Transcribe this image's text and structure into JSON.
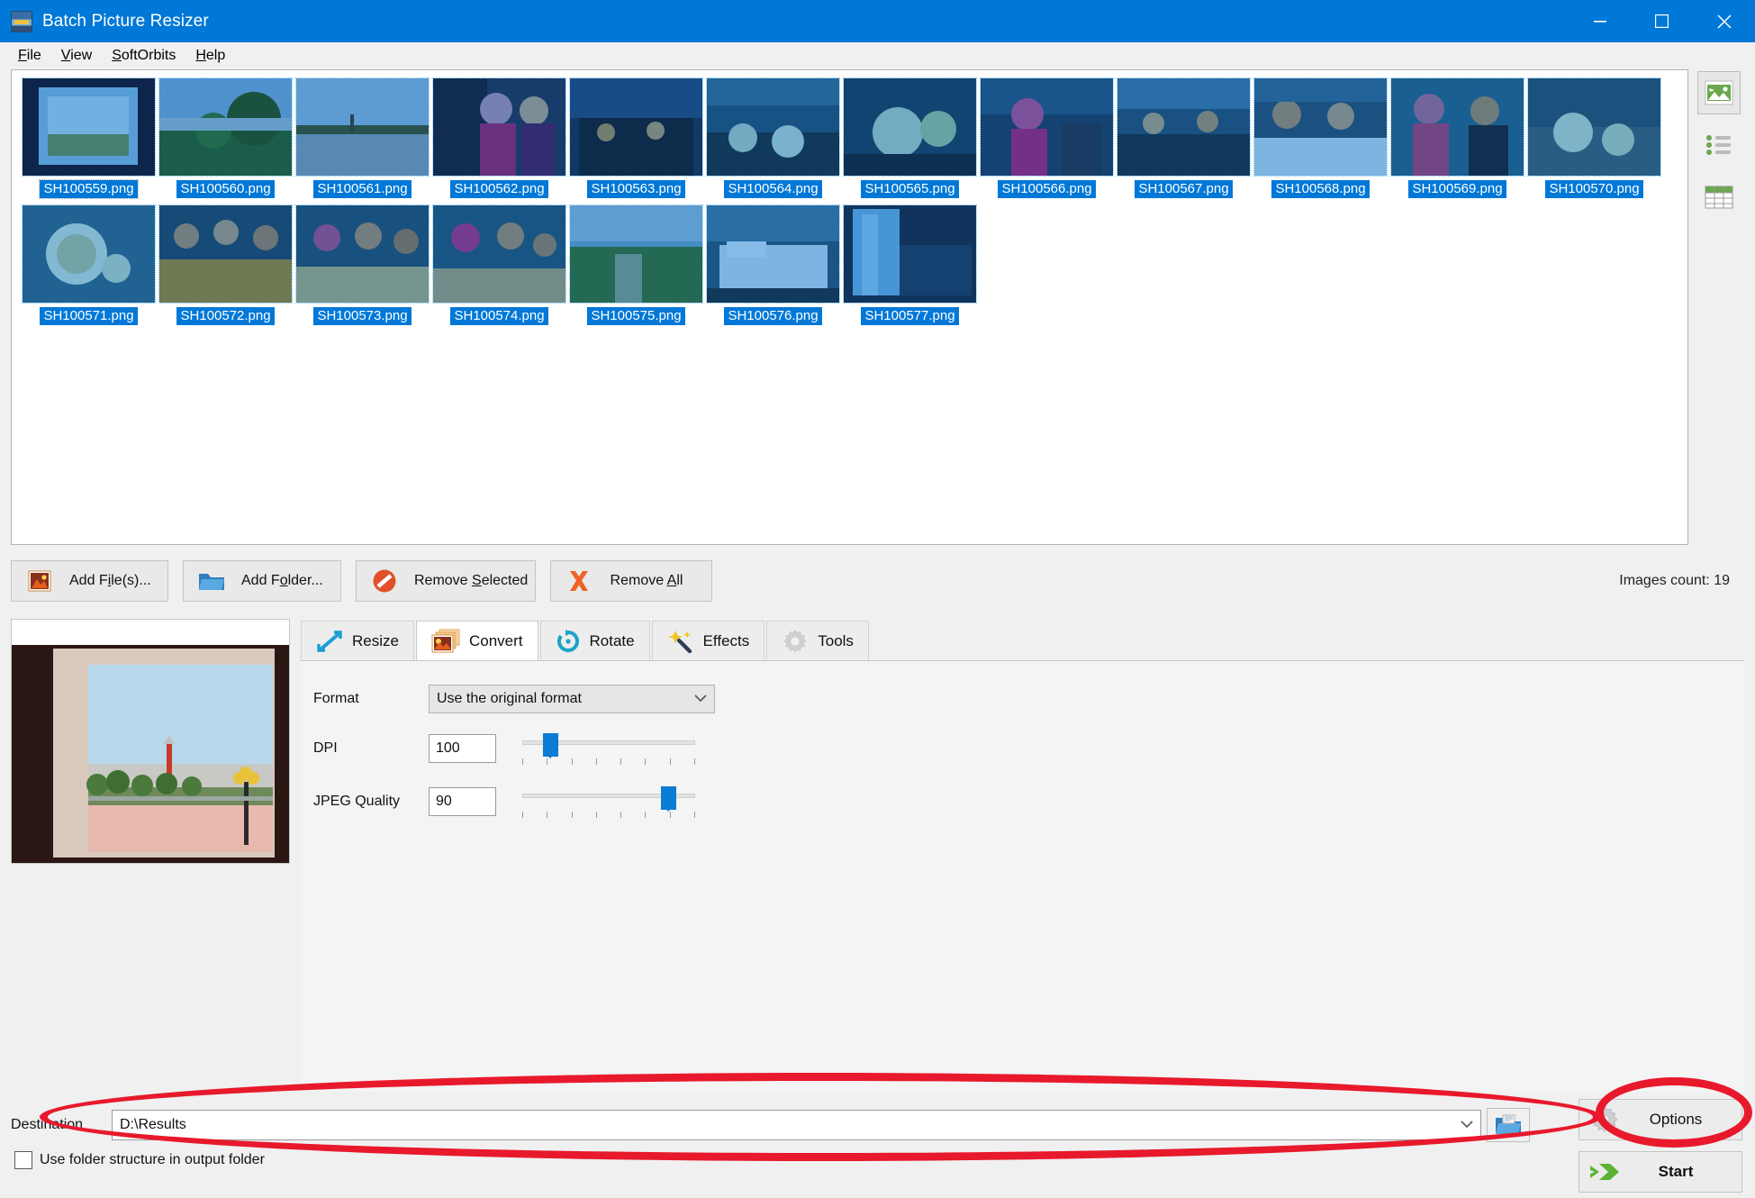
{
  "window": {
    "title": "Batch Picture Resizer",
    "icon": "app-icon",
    "minimize": "minimize-icon",
    "maximize": "maximize-icon",
    "close": "close-icon"
  },
  "menu": [
    {
      "label": "File",
      "mnemonic": "F"
    },
    {
      "label": "View",
      "mnemonic": "V"
    },
    {
      "label": "SoftOrbits",
      "mnemonic": "S"
    },
    {
      "label": "Help",
      "mnemonic": "H"
    }
  ],
  "thumbnails": [
    {
      "label": "SH100559.png",
      "scene": "window-view"
    },
    {
      "label": "SH100560.png",
      "scene": "garden"
    },
    {
      "label": "SH100561.png",
      "scene": "promenade"
    },
    {
      "label": "SH100562.png",
      "scene": "people-night"
    },
    {
      "label": "SH100563.png",
      "scene": "lobby"
    },
    {
      "label": "SH100564.png",
      "scene": "buffet"
    },
    {
      "label": "SH100565.png",
      "scene": "buffet-table"
    },
    {
      "label": "SH100566.png",
      "scene": "restaurant"
    },
    {
      "label": "SH100567.png",
      "scene": "terrace"
    },
    {
      "label": "SH100568.png",
      "scene": "table-people"
    },
    {
      "label": "SH100569.png",
      "scene": "couple-table"
    },
    {
      "label": "SH100570.png",
      "scene": "food-plate"
    },
    {
      "label": "SH100571.png",
      "scene": "food-dish"
    },
    {
      "label": "SH100572.png",
      "scene": "group-dinner"
    },
    {
      "label": "SH100573.png",
      "scene": "group-table"
    },
    {
      "label": "SH100574.png",
      "scene": "family-table"
    },
    {
      "label": "SH100575.png",
      "scene": "garden-path"
    },
    {
      "label": "SH100576.png",
      "scene": "hotel-bed"
    },
    {
      "label": "SH100577.png",
      "scene": "room-curtain"
    }
  ],
  "view_modes": [
    {
      "name": "thumbnail-view",
      "active": true
    },
    {
      "name": "list-view",
      "active": false
    },
    {
      "name": "details-view",
      "active": false
    }
  ],
  "actions": {
    "add_files": {
      "pre": "Add F",
      "mn": "i",
      "post": "le(s)..."
    },
    "add_folder": {
      "pre": "Add F",
      "mn": "o",
      "post": "lder..."
    },
    "remove_selected": {
      "pre": "Remove ",
      "mn": "S",
      "post": "elected"
    },
    "remove_all": {
      "pre": "Remove ",
      "mn": "A",
      "post": "ll"
    },
    "images_count": "Images count: 19"
  },
  "tabs": [
    {
      "label": "Resize",
      "icon": "resize-arrows-icon",
      "active": false
    },
    {
      "label": "Convert",
      "icon": "convert-images-icon",
      "active": true
    },
    {
      "label": "Rotate",
      "icon": "rotate-circular-icon",
      "active": false
    },
    {
      "label": "Effects",
      "icon": "magic-wand-icon",
      "active": false
    },
    {
      "label": "Tools",
      "icon": "gear-icon",
      "active": false
    }
  ],
  "convert_panel": {
    "format_label": "Format",
    "format_value": "Use the original format",
    "dpi_label": "DPI",
    "dpi_value": "100",
    "dpi_slider_percent": 13,
    "jpeg_label": "JPEG Quality",
    "jpeg_value": "90",
    "jpeg_slider_percent": 88
  },
  "footer": {
    "destination_label": "Destination",
    "destination_value": "D:\\Results",
    "browse_icon": "folder-browse-icon",
    "use_folder_structure": "Use folder structure in output folder",
    "options_label": "Options",
    "options_icon": "gear-icon",
    "start_label": "Start",
    "start_icon": "green-arrow-icon"
  },
  "colors": {
    "title_bar": "#0078d7",
    "selection": "#0078d7",
    "annotation": "#e8192c",
    "start_green": "#5db233",
    "slider_blue": "#0a7cd4"
  }
}
